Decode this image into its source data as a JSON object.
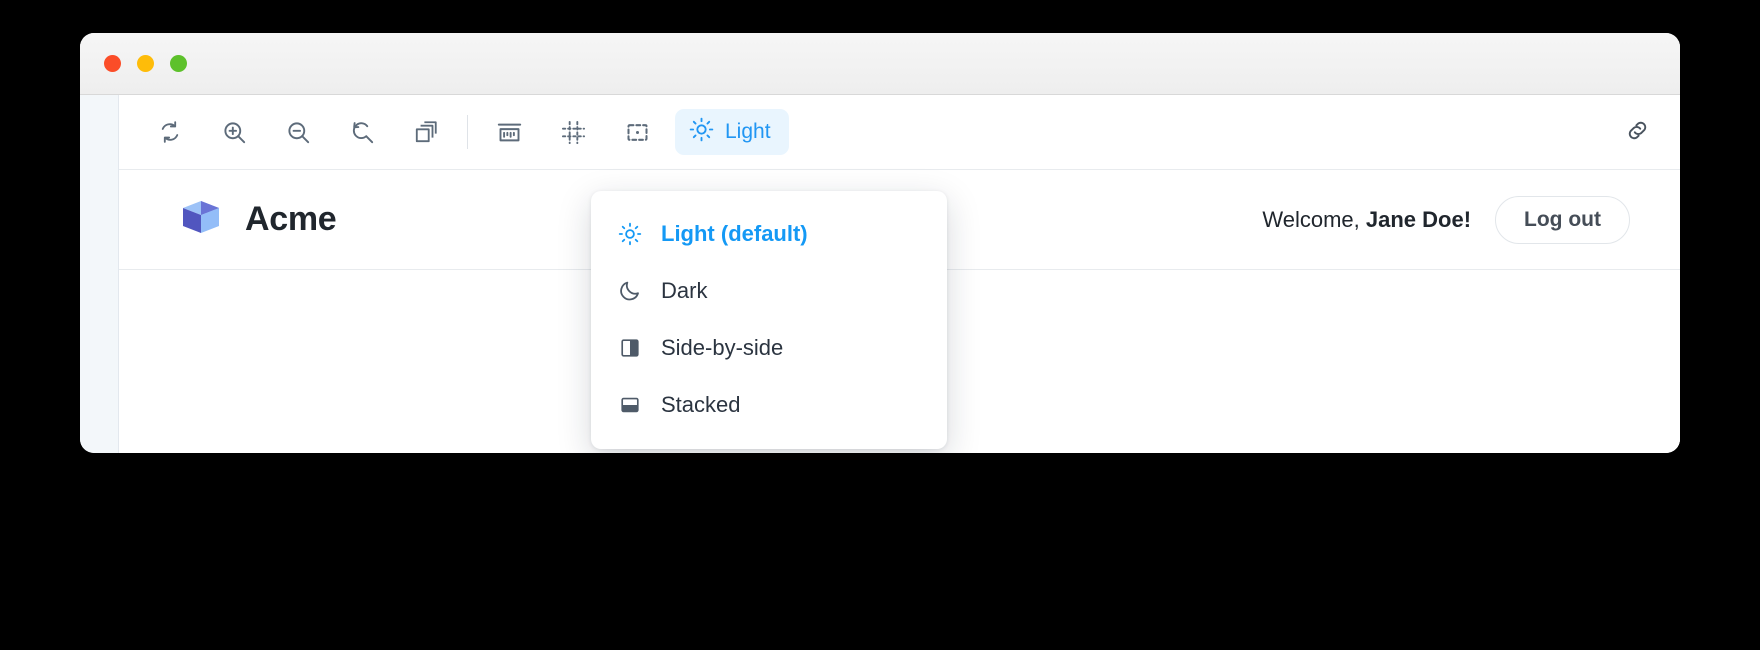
{
  "window": {
    "traffic_lights": [
      {
        "name": "close",
        "color": "#fb4d28"
      },
      {
        "name": "minimize",
        "color": "#febc09"
      },
      {
        "name": "zoom",
        "color": "#5dc12b"
      }
    ]
  },
  "toolbar": {
    "tools": [
      {
        "id": "reload",
        "icon": "refresh-icon",
        "title": "Reload"
      },
      {
        "id": "zoom-in",
        "icon": "zoom-in-icon",
        "title": "Zoom in"
      },
      {
        "id": "zoom-out",
        "icon": "zoom-out-icon",
        "title": "Zoom out"
      },
      {
        "id": "reset-zoom",
        "icon": "reset-zoom-icon",
        "title": "Reset zoom"
      },
      {
        "id": "copy",
        "icon": "copy-layers-icon",
        "title": "Copy"
      }
    ],
    "tools_second": [
      {
        "id": "measure",
        "icon": "ruler-icon",
        "title": "Measure"
      },
      {
        "id": "grid",
        "icon": "grid-icon",
        "title": "Grid"
      },
      {
        "id": "focus",
        "icon": "focus-frame-icon",
        "title": "Focus"
      }
    ],
    "theme_button": {
      "label": "Light",
      "icon": "sun-icon",
      "accent_color": "#2196f3",
      "background_color": "#e9f5fe"
    },
    "link_button": {
      "icon": "link-icon",
      "title": "Copy link"
    }
  },
  "theme_menu": {
    "items": [
      {
        "label": "Light (default)",
        "icon": "sun-icon",
        "active": true
      },
      {
        "label": "Dark",
        "icon": "moon-icon",
        "active": false
      },
      {
        "label": "Side-by-side",
        "icon": "split-panes-icon",
        "active": false
      },
      {
        "label": "Stacked",
        "icon": "stacked-panes-icon",
        "active": false
      }
    ]
  },
  "app_header": {
    "logo_icon": "acme-cube-logo",
    "brand_name": "Acme",
    "welcome_prefix": "Welcome, ",
    "user_name": "Jane Doe!",
    "logout_label": "Log out"
  }
}
